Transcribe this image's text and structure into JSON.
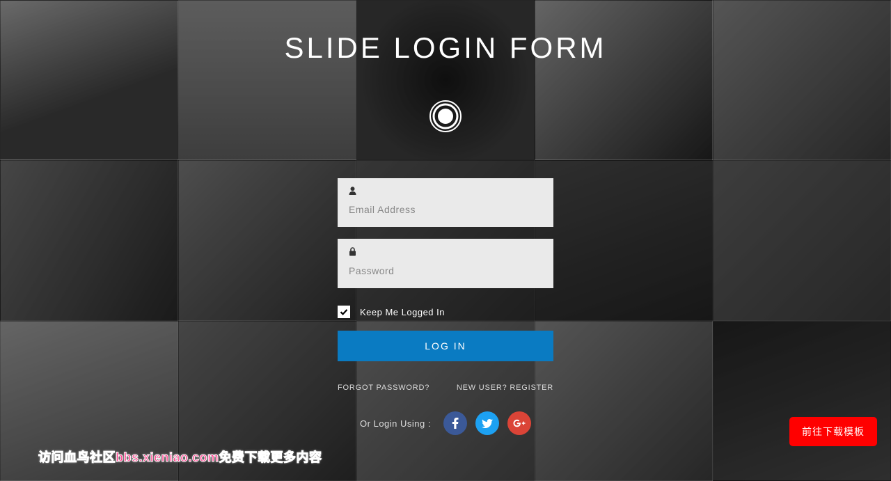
{
  "header": {
    "title": "SLIDE LOGIN FORM"
  },
  "form": {
    "email_placeholder": "Email Address",
    "password_placeholder": "Password",
    "keep_logged_label": "Keep Me Logged In",
    "login_button": "LOG IN"
  },
  "links": {
    "forgot_password": "FORGOT PASSWORD?",
    "register_prefix": "NEW USER? ",
    "register_link": "REGISTER"
  },
  "social": {
    "label": "Or Login Using :",
    "facebook": "facebook",
    "twitter": "twitter",
    "google_plus": "google-plus"
  },
  "float_button": "前往下载模板",
  "watermark": "访问血鸟社区bbs.xieniao.com免费下载更多内容",
  "colors": {
    "primary_button": "#0a7bc2",
    "float_button": "#ff0000",
    "facebook": "#3b5998",
    "twitter": "#1da1f2",
    "google": "#db4437"
  }
}
